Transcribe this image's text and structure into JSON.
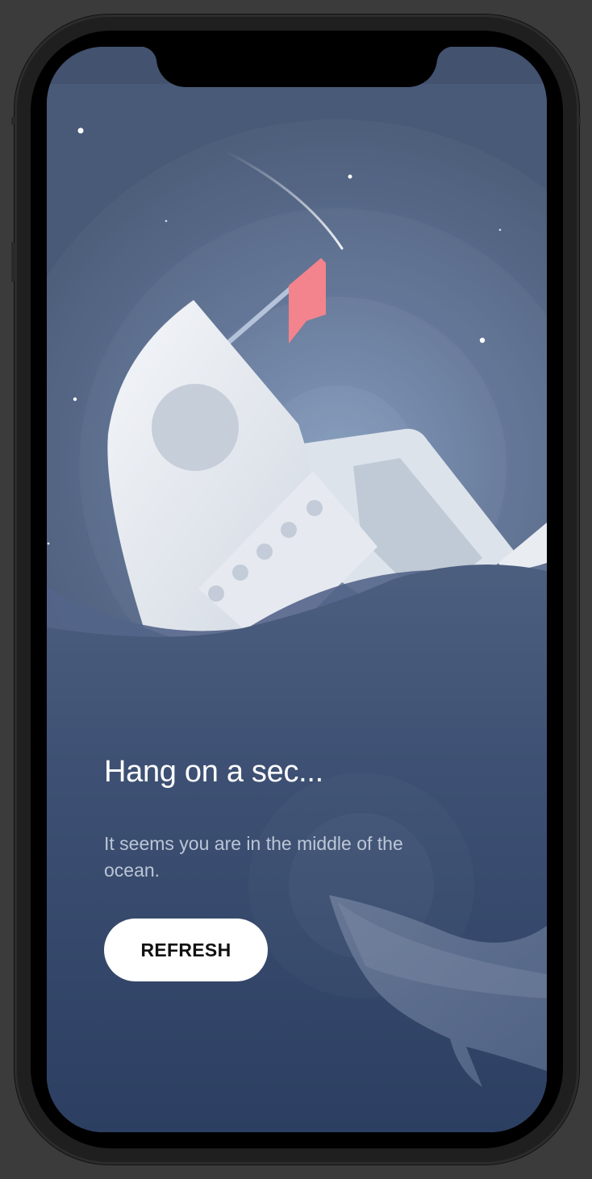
{
  "error_screen": {
    "title": "Hang on a sec...",
    "message": "It seems you are in the middle of the ocean.",
    "refresh_label": "REFRESH"
  },
  "colors": {
    "sky": "#495a78",
    "ocean": "#34476a",
    "flag": "#f3838d",
    "button_bg": "#ffffff",
    "button_text": "#111111"
  },
  "illustration": {
    "subject": "sinking-rocket-illustration",
    "icons": [
      "star-icon",
      "shooting-star-icon",
      "flag-icon",
      "whale-tail-icon"
    ]
  }
}
